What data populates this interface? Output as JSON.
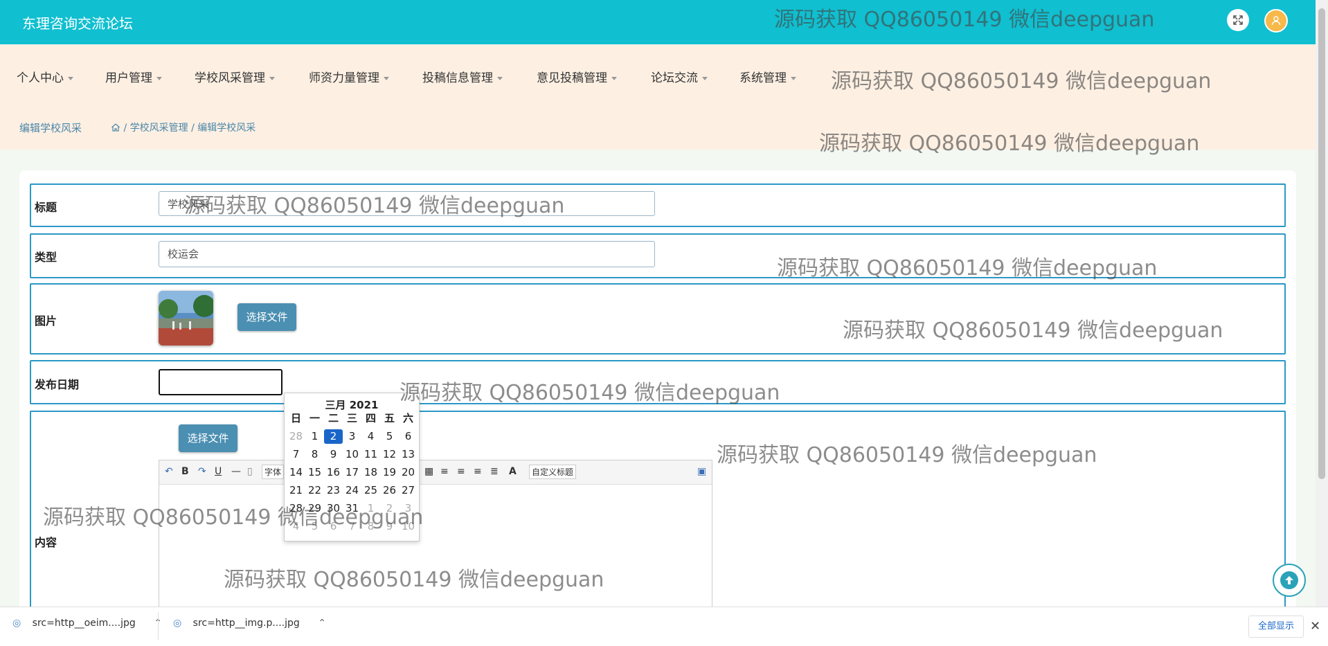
{
  "header": {
    "title": "东理咨询交流论坛"
  },
  "menu": {
    "items": [
      "个人中心",
      "用户管理",
      "学校风采管理",
      "师资力量管理",
      "投稿信息管理",
      "意见投稿管理",
      "论坛交流",
      "系统管理"
    ]
  },
  "breadcrumb": {
    "page": "编辑学校风采",
    "path1": "学校风采管理",
    "path2": "编辑学校风采",
    "sep": "/"
  },
  "form": {
    "title_label": "标题",
    "title_value": "学校风采",
    "type_label": "类型",
    "type_value": "校运会",
    "image_label": "图片",
    "choose_file": "选择文件",
    "date_label": "发布日期",
    "date_value": "",
    "content_label": "内容"
  },
  "calendar": {
    "title": "三月 2021",
    "weekdays": [
      "日",
      "一",
      "二",
      "三",
      "四",
      "五",
      "六"
    ],
    "weeks": [
      [
        "28",
        "1",
        "2",
        "3",
        "4",
        "5",
        "6"
      ],
      [
        "7",
        "8",
        "9",
        "10",
        "11",
        "12",
        "13"
      ],
      [
        "14",
        "15",
        "16",
        "17",
        "18",
        "19",
        "20"
      ],
      [
        "21",
        "22",
        "23",
        "24",
        "25",
        "26",
        "27"
      ],
      [
        "28",
        "29",
        "30",
        "31",
        "1",
        "2",
        "3"
      ],
      [
        "4",
        "5",
        "6",
        "7",
        "8",
        "9",
        "10"
      ]
    ],
    "selected": "2"
  },
  "editor": {
    "font_label": "字体",
    "custom_title": "自定义标题",
    "bold": "B",
    "underline": "U",
    "font_color": "A"
  },
  "watermark": "源码获取 QQ86050149 微信deepguan",
  "downloads": {
    "file1": "src=http__oeim....jpg",
    "file2": "src=http__img.p....jpg",
    "show_all": "全部显示"
  },
  "colors": {
    "topbar": "#10bfd0",
    "menubar": "#fdf0e3",
    "row_border": "#2a98c6",
    "button": "#4b8fb2",
    "selected_day": "#1a66c8"
  }
}
